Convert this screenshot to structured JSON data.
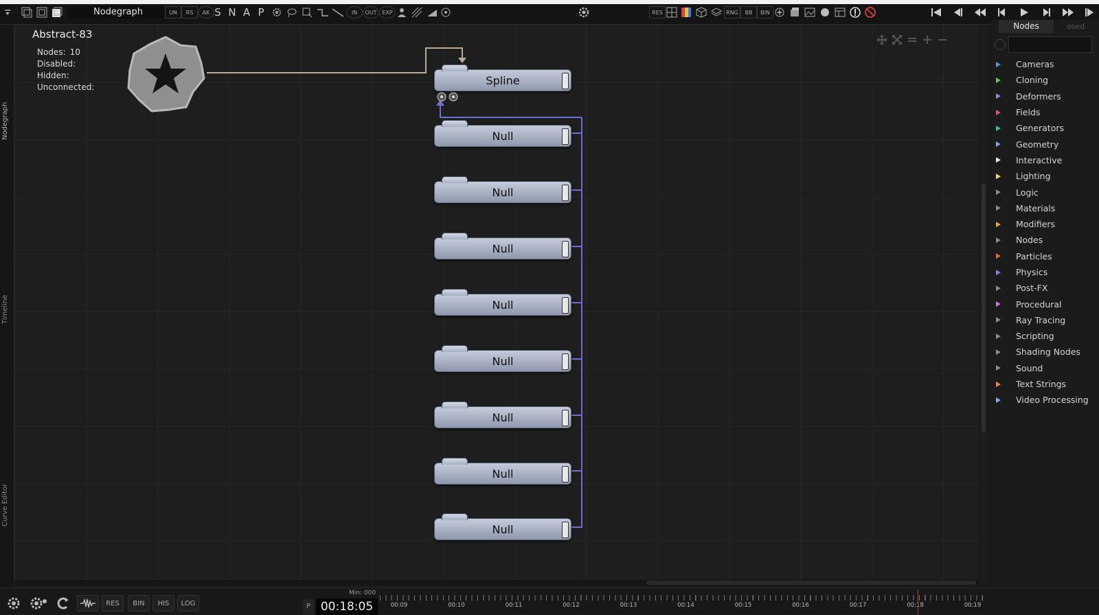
{
  "app": {
    "panel_title": "Nodegraph",
    "toolbar_letters": [
      "S",
      "N",
      "A",
      "P"
    ],
    "toolbar_small": [
      "UN",
      "RS",
      "AK",
      "IN",
      "OUT",
      "EXP"
    ],
    "toolbar_right_small": [
      "RES",
      "RNG",
      "BB",
      "BIN"
    ]
  },
  "left_tabs": [
    "Nodegraph",
    "Timeline",
    "Curve Editor"
  ],
  "scene": {
    "title": "Abstract-83",
    "stats": [
      {
        "label": "Nodes:",
        "value": "10"
      },
      {
        "label": "Disabled:",
        "value": ""
      },
      {
        "label": "Hidden:",
        "value": ""
      },
      {
        "label": "Unconnected:",
        "value": ""
      }
    ]
  },
  "graph": {
    "spline_label": "Spline",
    "null_labels": [
      "Null",
      "Null",
      "Null",
      "Null",
      "Null",
      "Null",
      "Null",
      "Null"
    ]
  },
  "sidebar": {
    "active_tab": "Nodes",
    "inactive_tab": "osed",
    "search_placeholder": "",
    "items": [
      {
        "label": "Cameras",
        "color": "#5b8fd9"
      },
      {
        "label": "Cloning",
        "color": "#6bc36b"
      },
      {
        "label": "Deformers",
        "color": "#9a86d6"
      },
      {
        "label": "Fields",
        "color": "#d9508a"
      },
      {
        "label": "Generators",
        "color": "#3bbfa8"
      },
      {
        "label": "Geometry",
        "color": "#7da2e0"
      },
      {
        "label": "Interactive",
        "color": "#e8e8e8"
      },
      {
        "label": "Lighting",
        "color": "#e6dc78"
      },
      {
        "label": "Logic",
        "color": "#8a8a8a"
      },
      {
        "label": "Materials",
        "color": "#8a8a8a"
      },
      {
        "label": "Modifiers",
        "color": "#e8a63a"
      },
      {
        "label": "Nodes",
        "color": "#8a8a8a"
      },
      {
        "label": "Particles",
        "color": "#e36a3a"
      },
      {
        "label": "Physics",
        "color": "#7d86d9"
      },
      {
        "label": "Post-FX",
        "color": "#8a8a8a"
      },
      {
        "label": "Procedural",
        "color": "#e070d8"
      },
      {
        "label": "Ray Tracing",
        "color": "#8a8a8a"
      },
      {
        "label": "Scripting",
        "color": "#8a8a8a"
      },
      {
        "label": "Shading Nodes",
        "color": "#8a8a8a"
      },
      {
        "label": "Sound",
        "color": "#8a8a8a"
      },
      {
        "label": "Text Strings",
        "color": "#e8884a"
      },
      {
        "label": "Video Processing",
        "color": "#7fb0e6"
      }
    ]
  },
  "bottom": {
    "buttons": [
      "RES",
      "BIN",
      "HIS",
      "LOG"
    ],
    "p_label": "P",
    "time": "00:18:05",
    "min_label": "Min: 000",
    "ticks": [
      "00:09",
      "00:10",
      "00:11",
      "00:12",
      "00:13",
      "00:14",
      "00:15",
      "00:16",
      "00:17",
      "00:18",
      "00:19"
    ]
  }
}
